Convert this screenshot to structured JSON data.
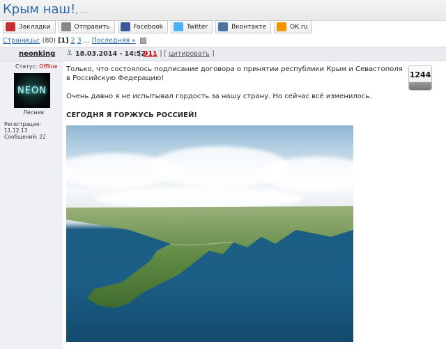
{
  "title": {
    "text": "Крым наш!",
    "suffix": ", ..."
  },
  "share": [
    {
      "label": "Закладки",
      "icon": "bookmarks-icon",
      "color": "#c03030"
    },
    {
      "label": "Отправить",
      "icon": "mail-icon",
      "color": "#888888"
    },
    {
      "label": "Facebook",
      "icon": "facebook-icon",
      "color": "#3b5998"
    },
    {
      "label": "Twitter",
      "icon": "twitter-icon",
      "color": "#4ab3f4"
    },
    {
      "label": "Вконтакте",
      "icon": "vkontakte-icon",
      "color": "#4c75a3"
    },
    {
      "label": "OK.ru",
      "icon": "odnoklassniki-icon",
      "color": "#f59300"
    }
  ],
  "pagination": {
    "label": "Страницы:",
    "total": "(80)",
    "current": "[1]",
    "p2": "2",
    "p3": "3",
    "ellipsis": "...",
    "last": "Последняя »"
  },
  "post": {
    "author": "neonking",
    "anchor": "⚓",
    "date": "18.03.2014 - 14:52",
    "num_open": "[",
    "number": "911",
    "num_close": "] [",
    "quote": "цитировать",
    "quote_close": "]",
    "status_label": "Статус:",
    "status_value": "Offline",
    "avatar_text": "NEON",
    "rank": "Лесник",
    "registration": "Регистрация: 11.12.13",
    "messages": "Сообщений: 22",
    "text1": "Только, что состоялось подписание договора о принятии республики Крым и Севастополя в Российскую Федерацию!",
    "text2": "Очень давно я не испытывал гордость за нашу страну. Но сейчас всё изменилось.",
    "text3": "СЕГОДНЯ Я ГОРЖУСЬ РОССИЕЙ!",
    "counter": "1244"
  }
}
